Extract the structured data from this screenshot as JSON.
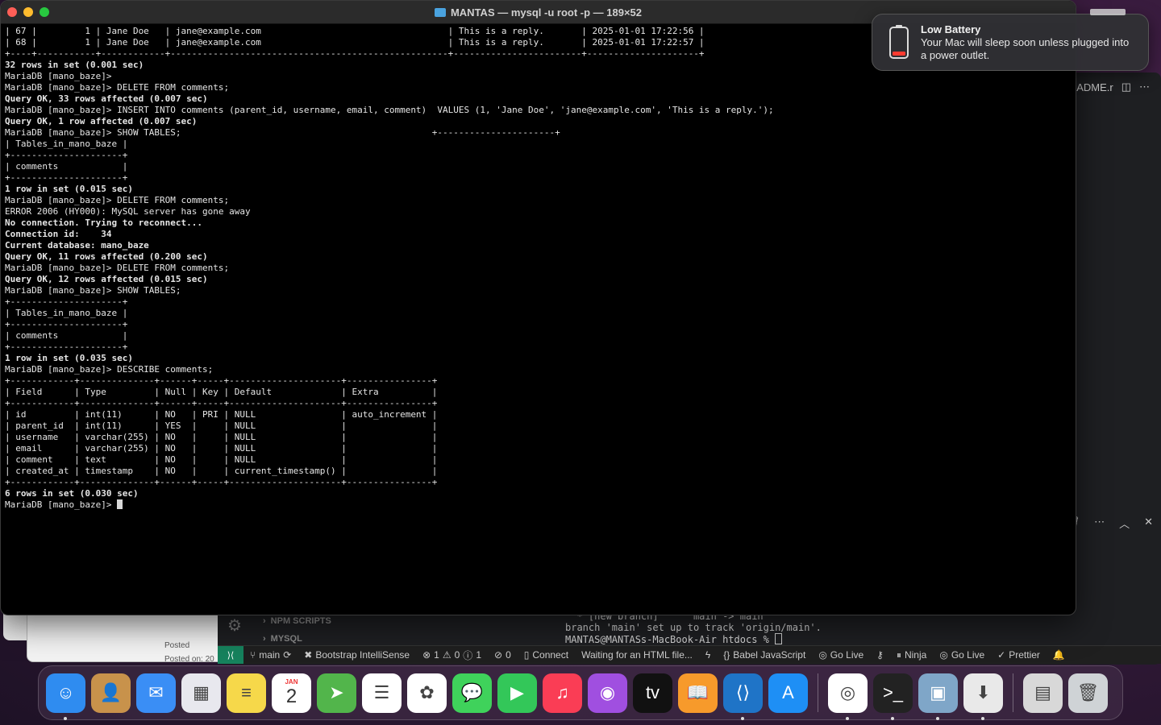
{
  "terminal": {
    "title": "MANTAS — mysql -u root -p — 189×52",
    "lines": [
      "| 67 |         1 | Jane Doe   | jane@example.com                                   | This is a reply.       | 2025-01-01 17:22:56 |",
      "| 68 |         1 | Jane Doe   | jane@example.com                                   | This is a reply.       | 2025-01-01 17:22:57 |",
      "+----+-----------+------------+----------------------------------------------------+------------------------+---------------------+",
      "32 rows in set (0.001 sec)",
      "",
      "MariaDB [mano_baze]>",
      "MariaDB [mano_baze]> DELETE FROM comments;",
      "Query OK, 33 rows affected (0.007 sec)",
      "",
      "MariaDB [mano_baze]> INSERT INTO comments (parent_id, username, email, comment)  VALUES (1, 'Jane Doe', 'jane@example.com', 'This is a reply.');",
      "Query OK, 1 row affected (0.007 sec)",
      "",
      "MariaDB [mano_baze]> SHOW TABLES;                                               +----------------------+",
      "| Tables_in_mano_baze |",
      "+---------------------+",
      "| comments            |",
      "+---------------------+",
      "1 row in set (0.015 sec)",
      "",
      "MariaDB [mano_baze]> DELETE FROM comments;",
      "ERROR 2006 (HY000): MySQL server has gone away",
      "No connection. Trying to reconnect...",
      "Connection id:    34",
      "Current database: mano_baze",
      "",
      "Query OK, 11 rows affected (0.200 sec)",
      "",
      "MariaDB [mano_baze]> DELETE FROM comments;",
      "Query OK, 12 rows affected (0.015 sec)",
      "",
      "MariaDB [mano_baze]> SHOW TABLES;",
      "+---------------------+",
      "| Tables_in_mano_baze |",
      "+---------------------+",
      "| comments            |",
      "+---------------------+",
      "1 row in set (0.035 sec)",
      "",
      "MariaDB [mano_baze]> DESCRIBE comments;",
      "+------------+--------------+------+-----+---------------------+----------------+",
      "| Field      | Type         | Null | Key | Default             | Extra          |",
      "+------------+--------------+------+-----+---------------------+----------------+",
      "| id         | int(11)      | NO   | PRI | NULL                | auto_increment |",
      "| parent_id  | int(11)      | YES  |     | NULL                |                |",
      "| username   | varchar(255) | NO   |     | NULL                |                |",
      "| email      | varchar(255) | NO   |     | NULL                |                |",
      "| comment    | text         | NO   |     | NULL                |                |",
      "| created_at | timestamp    | NO   |     | current_timestamp() |                |",
      "+------------+--------------+------+-----+---------------------+----------------+",
      "6 rows in set (0.030 sec)",
      "",
      "MariaDB [mano_baze]> "
    ],
    "bold_prefixes": [
      "rows in set",
      "row in set",
      "Query OK",
      "No connection",
      "Connection id",
      "Current database"
    ]
  },
  "notification": {
    "title": "Low Battery",
    "body": "Your Mac will sleep soon unless plugged into a power outlet.",
    "icon": "battery-low-icon"
  },
  "vscode": {
    "tab_fragment": "ADME.r",
    "sidebar_sections": [
      "NPM SCRIPTS",
      "MYSQL"
    ],
    "terminal_tail": [
      "  * [new branch]      main -> main",
      "branch 'main' set up to track 'origin/main'.",
      "MANTAS@MANTASs-MacBook-Air htdocs % "
    ],
    "status": {
      "branch": "main",
      "bootstrap": "Bootstrap IntelliSense",
      "errors": "1",
      "warnings": "0",
      "info": "1",
      "ports": "0",
      "connect": "Connect",
      "waiting": "Waiting for an HTML file...",
      "babel": "Babel JavaScript",
      "golive1": "Go Live",
      "ninja": "Ninja",
      "golive2": "Go Live",
      "prettier": "Prettier"
    }
  },
  "background_window": {
    "posted1": "Posted",
    "posted2": "Posted on: 20"
  },
  "dock": {
    "calendar_month": "JAN",
    "calendar_day": "2",
    "apps": [
      {
        "name": "Finder",
        "icon": "finder-icon",
        "color": "#2f8cf0",
        "running": true
      },
      {
        "name": "Contacts",
        "icon": "contacts-icon",
        "color": "#c8924b",
        "running": false
      },
      {
        "name": "Mail",
        "icon": "mail-icon",
        "color": "#3a8ef5",
        "running": false
      },
      {
        "name": "Launchpad",
        "icon": "launchpad-icon",
        "color": "#e8e8ee",
        "running": false
      },
      {
        "name": "Notes",
        "icon": "notes-icon",
        "color": "#f6d84a",
        "running": false
      },
      {
        "name": "Calendar",
        "icon": "calendar-icon",
        "color": "#ffffff",
        "running": false
      },
      {
        "name": "Maps",
        "icon": "maps-icon",
        "color": "#52b54b",
        "running": false
      },
      {
        "name": "Reminders",
        "icon": "reminders-icon",
        "color": "#ffffff",
        "running": false
      },
      {
        "name": "Photos",
        "icon": "photos-icon",
        "color": "#ffffff",
        "running": false
      },
      {
        "name": "Messages",
        "icon": "messages-icon",
        "color": "#3fd25b",
        "running": false
      },
      {
        "name": "FaceTime",
        "icon": "facetime-icon",
        "color": "#33c759",
        "running": false
      },
      {
        "name": "Music",
        "icon": "music-icon",
        "color": "#fa3d55",
        "running": false
      },
      {
        "name": "Podcasts",
        "icon": "podcasts-icon",
        "color": "#a04fe0",
        "running": false
      },
      {
        "name": "TV",
        "icon": "tv-icon",
        "color": "#111111",
        "running": false
      },
      {
        "name": "Books",
        "icon": "books-icon",
        "color": "#f79a2b",
        "running": false
      },
      {
        "name": "VS Code",
        "icon": "vscode-icon",
        "color": "#1f74c7",
        "running": true
      },
      {
        "name": "App Store",
        "icon": "appstore-icon",
        "color": "#1e8ff5",
        "running": false
      }
    ],
    "apps_right": [
      {
        "name": "Chrome",
        "icon": "chrome-icon",
        "color": "#ffffff",
        "running": true
      },
      {
        "name": "Terminal",
        "icon": "terminal-icon",
        "color": "#222222",
        "running": true
      },
      {
        "name": "Preview",
        "icon": "preview-icon",
        "color": "#7fa6c8",
        "running": true
      },
      {
        "name": "Installer",
        "icon": "installer-icon",
        "color": "#e9e9e9",
        "running": true
      }
    ],
    "apps_end": [
      {
        "name": "Downloads",
        "icon": "downloads-stack-icon",
        "color": "#d8d8d8",
        "running": false
      },
      {
        "name": "Trash",
        "icon": "trash-icon",
        "color": "#cfd3d6",
        "running": false
      }
    ]
  }
}
